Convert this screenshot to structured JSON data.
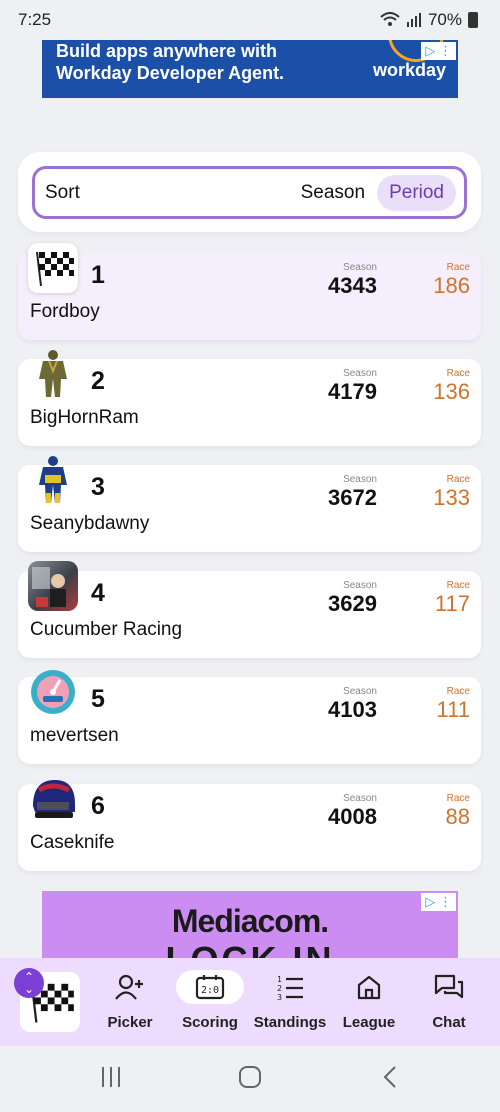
{
  "status_bar": {
    "time": "7:25",
    "battery": "70%"
  },
  "ad_top": {
    "headline_line1": "Build apps anywhere with",
    "headline_line2": "Workday Developer Agent.",
    "brand": "workday"
  },
  "sort": {
    "label": "Sort",
    "options": [
      "Season",
      "Period"
    ],
    "selected": "Period"
  },
  "standings_labels": {
    "season": "Season",
    "race": "Race"
  },
  "standings": [
    {
      "rank": "1",
      "name": "Fordboy",
      "season": "4343",
      "race": "186",
      "avatar": "checkered-flag-icon"
    },
    {
      "rank": "2",
      "name": "BigHornRam",
      "season": "4179",
      "race": "136",
      "avatar": "firesuit-olive-icon"
    },
    {
      "rank": "3",
      "name": "Seanybdawny",
      "season": "3672",
      "race": "133",
      "avatar": "firesuit-blue-yellow-icon"
    },
    {
      "rank": "4",
      "name": "Cucumber Racing",
      "season": "3629",
      "race": "117",
      "avatar": "photo-avatar"
    },
    {
      "rank": "5",
      "name": "mevertsen",
      "season": "4103",
      "race": "111",
      "avatar": "fantrax-gauge-icon"
    },
    {
      "rank": "6",
      "name": "Caseknife",
      "season": "4008",
      "race": "88",
      "avatar": "helmet-icon"
    }
  ],
  "ad_bottom": {
    "brand": "Mediacom.",
    "tagline": "LOCK IN"
  },
  "bottom_nav": {
    "items": [
      {
        "label": "Picker",
        "icon": "add-user-icon"
      },
      {
        "label": "Scoring",
        "icon": "scoreboard-icon",
        "active": true
      },
      {
        "label": "Standings",
        "icon": "ranked-list-icon"
      },
      {
        "label": "League",
        "icon": "home-icon"
      },
      {
        "label": "Chat",
        "icon": "chat-icon"
      }
    ]
  },
  "colors": {
    "accent": "#7b3fd6",
    "race": "#d0732c",
    "highlight": "#f4eefd",
    "nav_bg": "#eddcfd"
  }
}
